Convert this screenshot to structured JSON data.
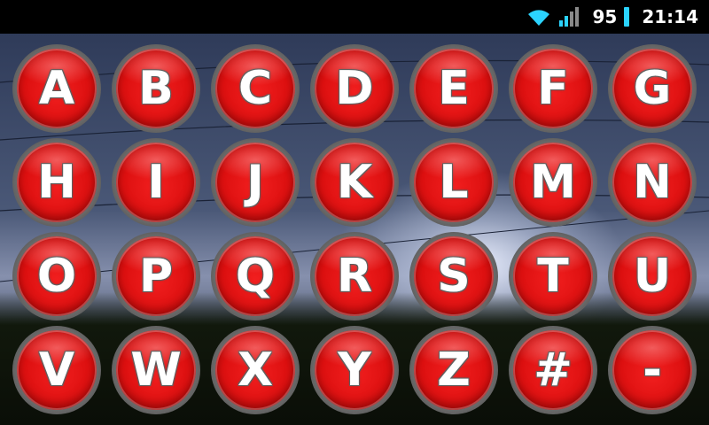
{
  "status_bar": {
    "battery_level": "95",
    "time": "21:14",
    "icons": [
      "wifi-icon",
      "signal-icon",
      "battery-icon"
    ]
  },
  "keys": [
    "A",
    "B",
    "C",
    "D",
    "E",
    "F",
    "G",
    "H",
    "I",
    "J",
    "K",
    "L",
    "M",
    "N",
    "O",
    "P",
    "Q",
    "R",
    "S",
    "T",
    "U",
    "V",
    "W",
    "X",
    "Y",
    "Z",
    "#",
    "-"
  ],
  "colors": {
    "key_face": "#e01414",
    "key_rim": "#7a7a7a",
    "battery_accent": "#2bd3ff"
  }
}
